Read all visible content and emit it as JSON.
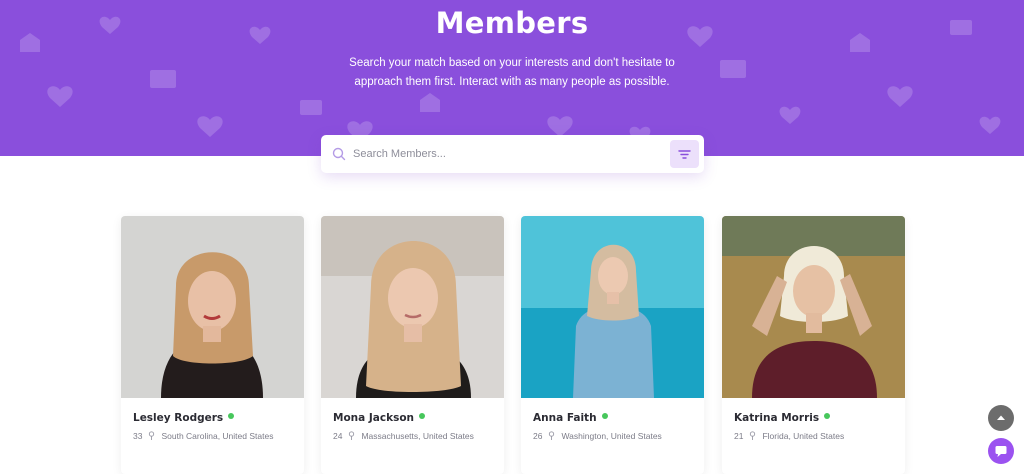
{
  "hero": {
    "title": "Members",
    "description": "Search your match based on your interests and don't hesitate to approach them first. Interact with as many people as possible."
  },
  "search": {
    "placeholder": "Search Members...",
    "icon": "search-icon",
    "filter_icon": "filter-icon"
  },
  "colors": {
    "hero_bg": "#8a4fdc",
    "accent": "#9b52f0",
    "online": "#47c75c",
    "filter_bg": "#ece0fb"
  },
  "members": [
    {
      "name": "Lesley Rodgers",
      "age": "33",
      "location": "South Carolina, United States",
      "online": true
    },
    {
      "name": "Mona Jackson",
      "age": "24",
      "location": "Massachusetts, United States",
      "online": true
    },
    {
      "name": "Anna Faith",
      "age": "26",
      "location": "Washington, United States",
      "online": true
    },
    {
      "name": "Katrina Morris",
      "age": "21",
      "location": "Florida, United States",
      "online": true
    }
  ],
  "floating": {
    "scroll_top_icon": "chevron-up-icon",
    "chat_icon": "chat-icon"
  }
}
